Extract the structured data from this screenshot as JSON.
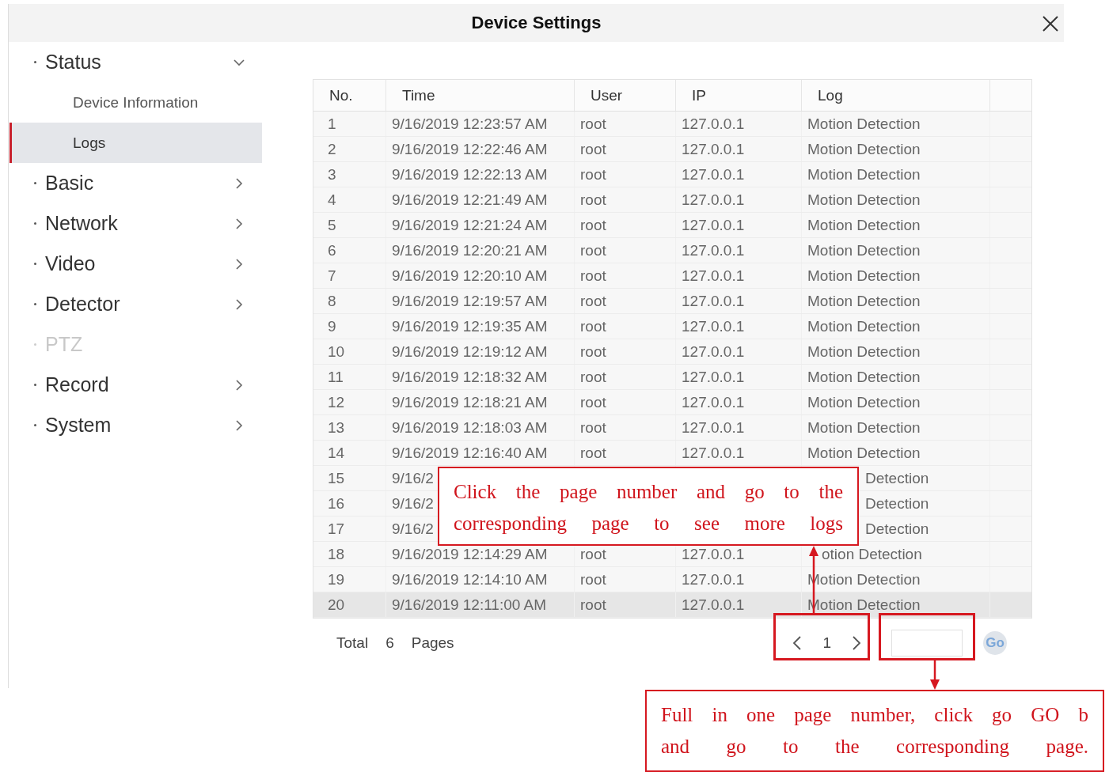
{
  "window": {
    "title": "Device Settings"
  },
  "sidebar": {
    "items": [
      {
        "label": "Status",
        "expanded": true,
        "disabled": false,
        "children": [
          {
            "label": "Device Information",
            "selected": false
          },
          {
            "label": "Logs",
            "selected": true
          }
        ]
      },
      {
        "label": "Basic",
        "expanded": false,
        "disabled": false
      },
      {
        "label": "Network",
        "expanded": false,
        "disabled": false
      },
      {
        "label": "Video",
        "expanded": false,
        "disabled": false
      },
      {
        "label": "Detector",
        "expanded": false,
        "disabled": false
      },
      {
        "label": "PTZ",
        "expanded": false,
        "disabled": true
      },
      {
        "label": "Record",
        "expanded": false,
        "disabled": false
      },
      {
        "label": "System",
        "expanded": false,
        "disabled": false
      }
    ]
  },
  "table": {
    "columns": [
      "No.",
      "Time",
      "User",
      "IP",
      "Log"
    ],
    "rows": [
      {
        "kind": "full",
        "selected": false,
        "no": "1",
        "time": "9/16/2019 12:23:57 AM",
        "user": "root",
        "ip": "127.0.0.1",
        "log": "Motion Detection"
      },
      {
        "kind": "full",
        "selected": false,
        "no": "2",
        "time": "9/16/2019 12:22:46 AM",
        "user": "root",
        "ip": "127.0.0.1",
        "log": "Motion Detection"
      },
      {
        "kind": "full",
        "selected": false,
        "no": "3",
        "time": "9/16/2019 12:22:13 AM",
        "user": "root",
        "ip": "127.0.0.1",
        "log": "Motion Detection"
      },
      {
        "kind": "full",
        "selected": false,
        "no": "4",
        "time": "9/16/2019 12:21:49 AM",
        "user": "root",
        "ip": "127.0.0.1",
        "log": "Motion Detection"
      },
      {
        "kind": "full",
        "selected": false,
        "no": "5",
        "time": "9/16/2019 12:21:24 AM",
        "user": "root",
        "ip": "127.0.0.1",
        "log": "Motion Detection"
      },
      {
        "kind": "full",
        "selected": false,
        "no": "6",
        "time": "9/16/2019 12:20:21 AM",
        "user": "root",
        "ip": "127.0.0.1",
        "log": "Motion Detection"
      },
      {
        "kind": "full",
        "selected": false,
        "no": "7",
        "time": "9/16/2019 12:20:10 AM",
        "user": "root",
        "ip": "127.0.0.1",
        "log": "Motion Detection"
      },
      {
        "kind": "full",
        "selected": false,
        "no": "8",
        "time": "9/16/2019 12:19:57 AM",
        "user": "root",
        "ip": "127.0.0.1",
        "log": "Motion Detection"
      },
      {
        "kind": "full",
        "selected": false,
        "no": "9",
        "time": "9/16/2019 12:19:35 AM",
        "user": "root",
        "ip": "127.0.0.1",
        "log": "Motion Detection"
      },
      {
        "kind": "full",
        "selected": false,
        "no": "10",
        "time": "9/16/2019 12:19:12 AM",
        "user": "root",
        "ip": "127.0.0.1",
        "log": "Motion Detection"
      },
      {
        "kind": "full",
        "selected": false,
        "no": "11",
        "time": "9/16/2019 12:18:32 AM",
        "user": "root",
        "ip": "127.0.0.1",
        "log": "Motion Detection"
      },
      {
        "kind": "full",
        "selected": false,
        "no": "12",
        "time": "9/16/2019 12:18:21 AM",
        "user": "root",
        "ip": "127.0.0.1",
        "log": "Motion Detection"
      },
      {
        "kind": "full",
        "selected": false,
        "no": "13",
        "time": "9/16/2019 12:18:03 AM",
        "user": "root",
        "ip": "127.0.0.1",
        "log": "Motion Detection"
      },
      {
        "kind": "full",
        "selected": false,
        "no": "14",
        "time": "9/16/2019 12:16:40 AM",
        "user": "root",
        "ip": "127.0.0.1",
        "log": "Motion Detection"
      },
      {
        "kind": "covered",
        "selected": false,
        "no": "15",
        "time": "9/16/2",
        "log": "Detection"
      },
      {
        "kind": "covered",
        "selected": false,
        "no": "16",
        "time": "9/16/2",
        "log": "Detection"
      },
      {
        "kind": "covered",
        "selected": false,
        "no": "17",
        "time": "9/16/2",
        "log": "Detection"
      },
      {
        "kind": "arrowed",
        "selected": false,
        "no": "18",
        "time": "9/16/2019 12:14:29 AM",
        "user": "root",
        "ip": "127.0.0.1",
        "log": "otion Detection"
      },
      {
        "kind": "full",
        "selected": false,
        "no": "19",
        "time": "9/16/2019 12:14:10 AM",
        "user": "root",
        "ip": "127.0.0.1",
        "log": "Motion Detection"
      },
      {
        "kind": "full",
        "selected": true,
        "no": "20",
        "time": "9/16/2019 12:11:00 AM",
        "user": "root",
        "ip": "127.0.0.1",
        "log": "Motion Detection"
      }
    ]
  },
  "pagination": {
    "total_label": "Total",
    "total_pages": "6",
    "pages_label": "Pages",
    "current_page": "1",
    "go_button": "Go"
  },
  "annotations": [
    {
      "kind": "above",
      "lines": [
        "Click the page number and go to the",
        "corresponding page to see more logs"
      ]
    },
    {
      "kind": "below",
      "lines": [
        "Full in one page number, click go GO b",
        "and go to the corresponding page."
      ]
    }
  ]
}
